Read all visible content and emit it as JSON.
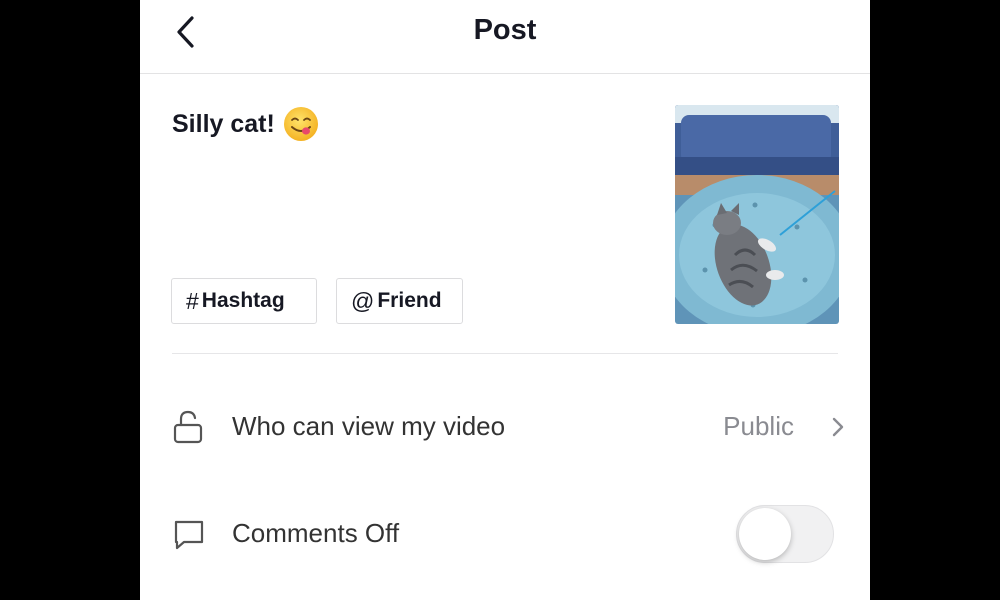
{
  "header": {
    "title": "Post",
    "back_icon": "chevron-left-icon"
  },
  "caption": {
    "text": "Silly cat!",
    "emoji": "yum-face-emoji"
  },
  "tags": [
    {
      "symbol": "#",
      "label": "Hashtag"
    },
    {
      "symbol": "@",
      "label": "Friend"
    }
  ],
  "thumbnail": {
    "subject": "cat lying on a blue tufted cushion"
  },
  "settings": {
    "privacy": {
      "icon": "unlock-icon",
      "label": "Who can view my video",
      "value": "Public",
      "chevron": "chevron-right-icon"
    },
    "comments": {
      "icon": "comment-icon",
      "label": "Comments Off",
      "toggle_on": false
    }
  },
  "colors": {
    "text": "#161823",
    "secondary": "#8a8b91",
    "divider": "#e6e6e8"
  }
}
